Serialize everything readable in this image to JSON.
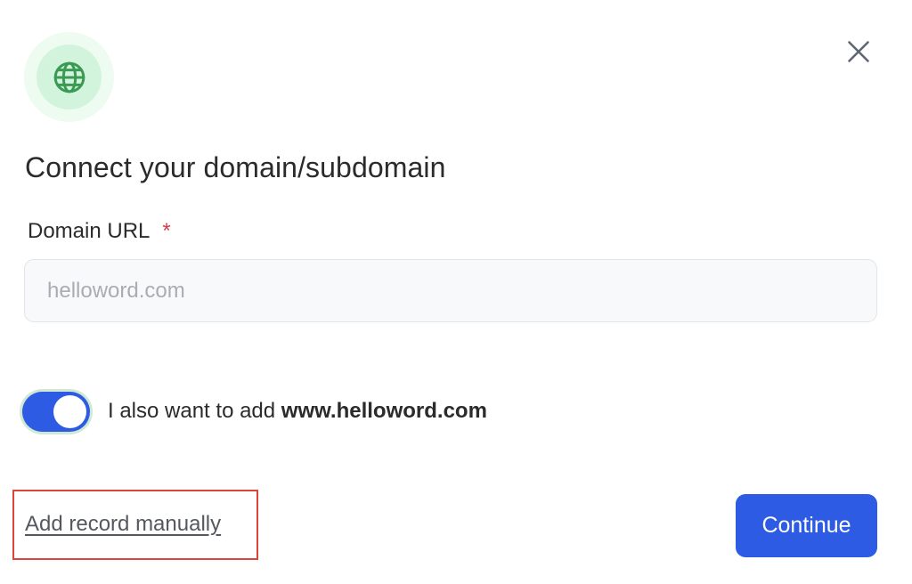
{
  "header": {
    "icon": "globe-icon",
    "close_icon": "close-icon"
  },
  "title": "Connect your domain/subdomain",
  "domain_field": {
    "label": "Domain URL",
    "required_mark": "*",
    "value": "",
    "placeholder": "helloword.com"
  },
  "www_toggle": {
    "checked": true,
    "label_prefix": "I also want to add ",
    "label_domain": "www.helloword.com"
  },
  "footer": {
    "manual_link": "Add record manually",
    "continue_label": "Continue"
  },
  "colors": {
    "primary": "#2d5be3",
    "icon_green": "#3a9a53",
    "icon_bg_outer": "#eefbf1",
    "icon_bg_inner": "#d3f4dc",
    "required": "#d93a4a",
    "highlight_box": "#dc4537"
  }
}
